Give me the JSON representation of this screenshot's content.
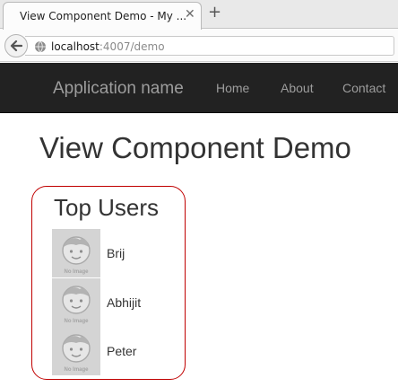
{
  "browser": {
    "tab_title": "View Component Demo - My ...",
    "close_glyph": "✕",
    "new_tab_glyph": "+",
    "url_host": "localhost",
    "url_rest": ":4007/demo",
    "icons": [
      "back-arrow-icon",
      "globe-icon",
      "close-icon",
      "plus-icon"
    ]
  },
  "navbar": {
    "brand": "Application name",
    "links": [
      "Home",
      "About",
      "Contact"
    ],
    "background": "#222222",
    "link_color": "#9d9d9d"
  },
  "page": {
    "title": "View Component Demo"
  },
  "top_users": {
    "title": "Top Users",
    "border_color": "#c00000",
    "avatar_caption": "No Image",
    "users": [
      {
        "name": "Brij"
      },
      {
        "name": "Abhijit"
      },
      {
        "name": "Peter"
      }
    ]
  }
}
